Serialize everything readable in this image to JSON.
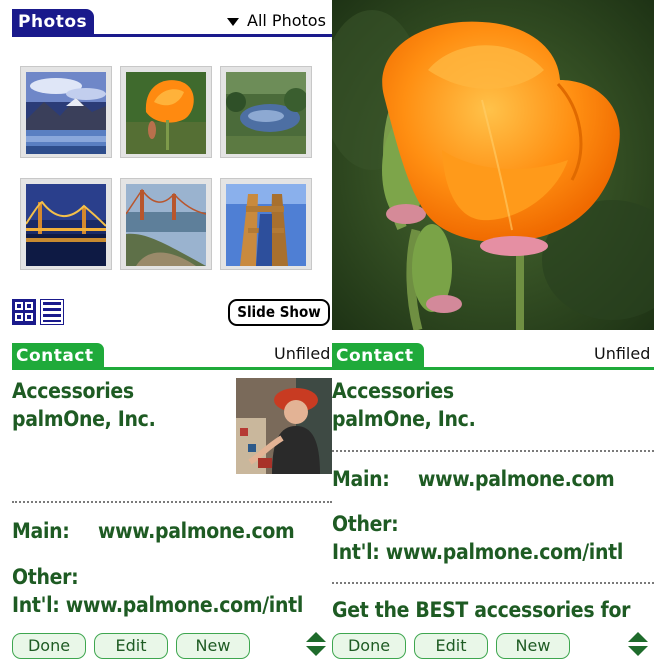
{
  "photos": {
    "tab_label": "Photos",
    "category": "All Photos",
    "slideshow_label": "Slide Show",
    "thumbnails": [
      "thumbnail-mountains",
      "thumbnail-poppy",
      "thumbnail-garden-pond",
      "thumbnail-bridge-night",
      "thumbnail-bridge-coast",
      "thumbnail-bridge-tower"
    ]
  },
  "contact_left": {
    "tab_label": "Contact",
    "category": "Unfiled",
    "name": "Accessories",
    "company": "palmOne, Inc.",
    "main_label": "Main:",
    "main_value": "www.palmone.com",
    "other_label": "Other:",
    "intl_line": "Int'l: www.palmone.com/intl",
    "buttons": {
      "done": "Done",
      "edit": "Edit",
      "new": "New"
    }
  },
  "contact_right": {
    "tab_label": "Contact",
    "category": "Unfiled",
    "name": "Accessories",
    "company": "palmOne, Inc.",
    "main_label": "Main:",
    "main_value": "www.palmone.com",
    "other_label": "Other:",
    "intl_line": "Int'l: www.palmone.com/intl",
    "note": "Get the BEST accessories for",
    "buttons": {
      "done": "Done",
      "edit": "Edit",
      "new": "New"
    }
  },
  "colors": {
    "photos_accent": "#1a1a8c",
    "contact_accent": "#1faa3a",
    "contact_text": "#1e5b23"
  }
}
